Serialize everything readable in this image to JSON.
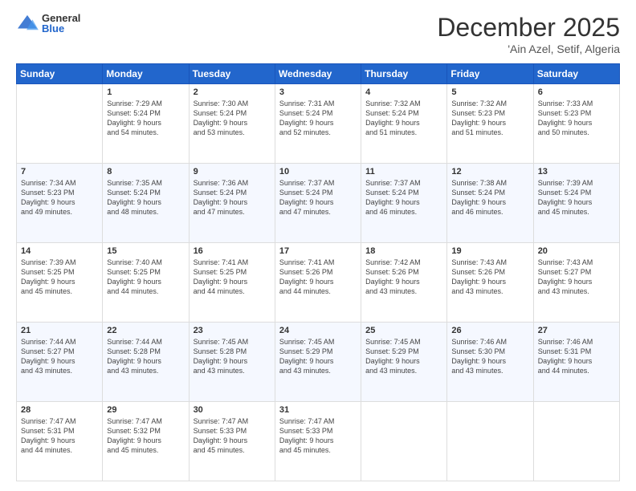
{
  "logo": {
    "general": "General",
    "blue": "Blue"
  },
  "header": {
    "month": "December 2025",
    "location": "'Ain Azel, Setif, Algeria"
  },
  "days_of_week": [
    "Sunday",
    "Monday",
    "Tuesday",
    "Wednesday",
    "Thursday",
    "Friday",
    "Saturday"
  ],
  "weeks": [
    [
      {
        "day": "",
        "info": ""
      },
      {
        "day": "1",
        "info": "Sunrise: 7:29 AM\nSunset: 5:24 PM\nDaylight: 9 hours\nand 54 minutes."
      },
      {
        "day": "2",
        "info": "Sunrise: 7:30 AM\nSunset: 5:24 PM\nDaylight: 9 hours\nand 53 minutes."
      },
      {
        "day": "3",
        "info": "Sunrise: 7:31 AM\nSunset: 5:24 PM\nDaylight: 9 hours\nand 52 minutes."
      },
      {
        "day": "4",
        "info": "Sunrise: 7:32 AM\nSunset: 5:24 PM\nDaylight: 9 hours\nand 51 minutes."
      },
      {
        "day": "5",
        "info": "Sunrise: 7:32 AM\nSunset: 5:23 PM\nDaylight: 9 hours\nand 51 minutes."
      },
      {
        "day": "6",
        "info": "Sunrise: 7:33 AM\nSunset: 5:23 PM\nDaylight: 9 hours\nand 50 minutes."
      }
    ],
    [
      {
        "day": "7",
        "info": "Sunrise: 7:34 AM\nSunset: 5:23 PM\nDaylight: 9 hours\nand 49 minutes."
      },
      {
        "day": "8",
        "info": "Sunrise: 7:35 AM\nSunset: 5:24 PM\nDaylight: 9 hours\nand 48 minutes."
      },
      {
        "day": "9",
        "info": "Sunrise: 7:36 AM\nSunset: 5:24 PM\nDaylight: 9 hours\nand 47 minutes."
      },
      {
        "day": "10",
        "info": "Sunrise: 7:37 AM\nSunset: 5:24 PM\nDaylight: 9 hours\nand 47 minutes."
      },
      {
        "day": "11",
        "info": "Sunrise: 7:37 AM\nSunset: 5:24 PM\nDaylight: 9 hours\nand 46 minutes."
      },
      {
        "day": "12",
        "info": "Sunrise: 7:38 AM\nSunset: 5:24 PM\nDaylight: 9 hours\nand 46 minutes."
      },
      {
        "day": "13",
        "info": "Sunrise: 7:39 AM\nSunset: 5:24 PM\nDaylight: 9 hours\nand 45 minutes."
      }
    ],
    [
      {
        "day": "14",
        "info": "Sunrise: 7:39 AM\nSunset: 5:25 PM\nDaylight: 9 hours\nand 45 minutes."
      },
      {
        "day": "15",
        "info": "Sunrise: 7:40 AM\nSunset: 5:25 PM\nDaylight: 9 hours\nand 44 minutes."
      },
      {
        "day": "16",
        "info": "Sunrise: 7:41 AM\nSunset: 5:25 PM\nDaylight: 9 hours\nand 44 minutes."
      },
      {
        "day": "17",
        "info": "Sunrise: 7:41 AM\nSunset: 5:26 PM\nDaylight: 9 hours\nand 44 minutes."
      },
      {
        "day": "18",
        "info": "Sunrise: 7:42 AM\nSunset: 5:26 PM\nDaylight: 9 hours\nand 43 minutes."
      },
      {
        "day": "19",
        "info": "Sunrise: 7:43 AM\nSunset: 5:26 PM\nDaylight: 9 hours\nand 43 minutes."
      },
      {
        "day": "20",
        "info": "Sunrise: 7:43 AM\nSunset: 5:27 PM\nDaylight: 9 hours\nand 43 minutes."
      }
    ],
    [
      {
        "day": "21",
        "info": "Sunrise: 7:44 AM\nSunset: 5:27 PM\nDaylight: 9 hours\nand 43 minutes."
      },
      {
        "day": "22",
        "info": "Sunrise: 7:44 AM\nSunset: 5:28 PM\nDaylight: 9 hours\nand 43 minutes."
      },
      {
        "day": "23",
        "info": "Sunrise: 7:45 AM\nSunset: 5:28 PM\nDaylight: 9 hours\nand 43 minutes."
      },
      {
        "day": "24",
        "info": "Sunrise: 7:45 AM\nSunset: 5:29 PM\nDaylight: 9 hours\nand 43 minutes."
      },
      {
        "day": "25",
        "info": "Sunrise: 7:45 AM\nSunset: 5:29 PM\nDaylight: 9 hours\nand 43 minutes."
      },
      {
        "day": "26",
        "info": "Sunrise: 7:46 AM\nSunset: 5:30 PM\nDaylight: 9 hours\nand 43 minutes."
      },
      {
        "day": "27",
        "info": "Sunrise: 7:46 AM\nSunset: 5:31 PM\nDaylight: 9 hours\nand 44 minutes."
      }
    ],
    [
      {
        "day": "28",
        "info": "Sunrise: 7:47 AM\nSunset: 5:31 PM\nDaylight: 9 hours\nand 44 minutes."
      },
      {
        "day": "29",
        "info": "Sunrise: 7:47 AM\nSunset: 5:32 PM\nDaylight: 9 hours\nand 45 minutes."
      },
      {
        "day": "30",
        "info": "Sunrise: 7:47 AM\nSunset: 5:33 PM\nDaylight: 9 hours\nand 45 minutes."
      },
      {
        "day": "31",
        "info": "Sunrise: 7:47 AM\nSunset: 5:33 PM\nDaylight: 9 hours\nand 45 minutes."
      },
      {
        "day": "",
        "info": ""
      },
      {
        "day": "",
        "info": ""
      },
      {
        "day": "",
        "info": ""
      }
    ]
  ]
}
